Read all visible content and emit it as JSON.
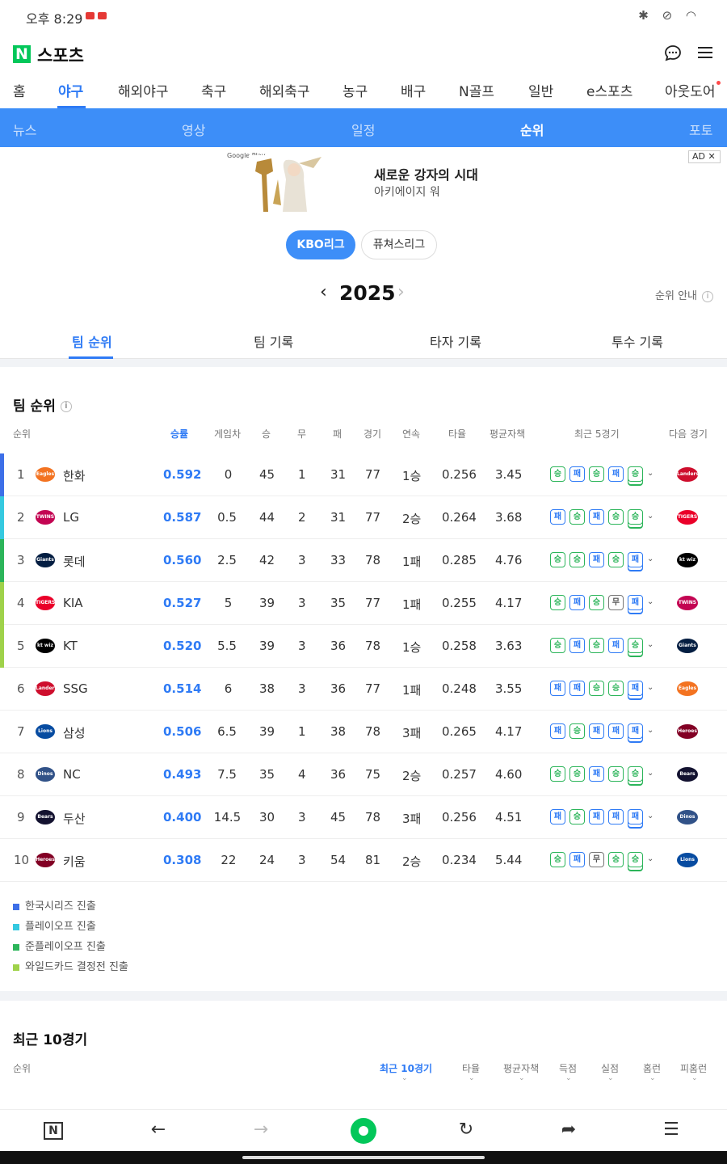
{
  "status": {
    "time": "오후 8:29",
    "icons": "✱ ⊘ ◠"
  },
  "header": {
    "logo_n": "N",
    "title": "스포츠",
    "chat_icon": "💬",
    "menu_icon": "☰"
  },
  "categories": [
    "홈",
    "야구",
    "해외야구",
    "축구",
    "해외축구",
    "농구",
    "배구",
    "N골프",
    "일반",
    "e스포츠",
    "아웃도어"
  ],
  "subnav": [
    "뉴스",
    "영상",
    "일정",
    "순위",
    "포토"
  ],
  "ad": {
    "store": "Google Play",
    "title": "새로운 강자의 시대",
    "subtitle": "아키에이지 워",
    "badge": "AD ✕"
  },
  "league_tabs": [
    "KBO리그",
    "퓨쳐스리그"
  ],
  "season": {
    "year": "2025",
    "prev": "‹",
    "next": "›",
    "guide": "순위 안내"
  },
  "record_tabs": [
    "팀 순위",
    "팀 기록",
    "타자 기록",
    "투수 기록"
  ],
  "standings": {
    "title": "팀 순위",
    "headers": [
      "순위",
      "승률",
      "게임차",
      "승",
      "무",
      "패",
      "경기",
      "연속",
      "타율",
      "평균자책",
      "최근 5경기",
      "다음 경기"
    ],
    "rows": [
      {
        "rank": "1",
        "team": "한화",
        "logo": "Eagles",
        "pct": "0.592",
        "gb": "0",
        "w": "45",
        "d": "1",
        "l": "31",
        "g": "77",
        "streak": "1승",
        "avg": "0.256",
        "era": "3.45",
        "last5": [
          "승",
          "패",
          "승",
          "패",
          "승"
        ],
        "next": "Landers"
      },
      {
        "rank": "2",
        "team": "LG",
        "logo": "TWINS",
        "pct": "0.587",
        "gb": "0.5",
        "w": "44",
        "d": "2",
        "l": "31",
        "g": "77",
        "streak": "2승",
        "avg": "0.264",
        "era": "3.68",
        "last5": [
          "패",
          "승",
          "패",
          "승",
          "승"
        ],
        "next": "TIGERS"
      },
      {
        "rank": "3",
        "team": "롯데",
        "logo": "Giants",
        "pct": "0.560",
        "gb": "2.5",
        "w": "42",
        "d": "3",
        "l": "33",
        "g": "78",
        "streak": "1패",
        "avg": "0.285",
        "era": "4.76",
        "last5": [
          "승",
          "승",
          "패",
          "승",
          "패"
        ],
        "next": "kt wiz"
      },
      {
        "rank": "4",
        "team": "KIA",
        "logo": "TIGERS",
        "pct": "0.527",
        "gb": "5",
        "w": "39",
        "d": "3",
        "l": "35",
        "g": "77",
        "streak": "1패",
        "avg": "0.255",
        "era": "4.17",
        "last5": [
          "승",
          "패",
          "승",
          "무",
          "패"
        ],
        "next": "TWINS"
      },
      {
        "rank": "5",
        "team": "KT",
        "logo": "kt wiz",
        "pct": "0.520",
        "gb": "5.5",
        "w": "39",
        "d": "3",
        "l": "36",
        "g": "78",
        "streak": "1승",
        "avg": "0.258",
        "era": "3.63",
        "last5": [
          "승",
          "패",
          "승",
          "패",
          "승"
        ],
        "next": "Giants"
      },
      {
        "rank": "6",
        "team": "SSG",
        "logo": "Landers",
        "pct": "0.514",
        "gb": "6",
        "w": "38",
        "d": "3",
        "l": "36",
        "g": "77",
        "streak": "1패",
        "avg": "0.248",
        "era": "3.55",
        "last5": [
          "패",
          "패",
          "승",
          "승",
          "패"
        ],
        "next": "Eagles"
      },
      {
        "rank": "7",
        "team": "삼성",
        "logo": "Lions",
        "pct": "0.506",
        "gb": "6.5",
        "w": "39",
        "d": "1",
        "l": "38",
        "g": "78",
        "streak": "3패",
        "avg": "0.265",
        "era": "4.17",
        "last5": [
          "패",
          "승",
          "패",
          "패",
          "패"
        ],
        "next": "Heroes"
      },
      {
        "rank": "8",
        "team": "NC",
        "logo": "Dinos",
        "pct": "0.493",
        "gb": "7.5",
        "w": "35",
        "d": "4",
        "l": "36",
        "g": "75",
        "streak": "2승",
        "avg": "0.257",
        "era": "4.60",
        "last5": [
          "승",
          "승",
          "패",
          "승",
          "승"
        ],
        "next": "Bears"
      },
      {
        "rank": "9",
        "team": "두산",
        "logo": "Bears",
        "pct": "0.400",
        "gb": "14.5",
        "w": "30",
        "d": "3",
        "l": "45",
        "g": "78",
        "streak": "3패",
        "avg": "0.256",
        "era": "4.51",
        "last5": [
          "패",
          "승",
          "패",
          "패",
          "패"
        ],
        "next": "Dinos"
      },
      {
        "rank": "10",
        "team": "키움",
        "logo": "Heroes",
        "pct": "0.308",
        "gb": "22",
        "w": "24",
        "d": "3",
        "l": "54",
        "g": "81",
        "streak": "2승",
        "avg": "0.234",
        "era": "5.44",
        "last5": [
          "승",
          "패",
          "무",
          "승",
          "승"
        ],
        "next": "Lions"
      }
    ]
  },
  "legend": [
    {
      "label": "한국시리즈 진출",
      "color": "#3d6fe8"
    },
    {
      "label": "플레이오프 진출",
      "color": "#35c9e0"
    },
    {
      "label": "준플레이오프 진출",
      "color": "#2cb55a"
    },
    {
      "label": "와일드카드 결정전 진출",
      "color": "#9fd24a"
    }
  ],
  "recent10": {
    "title": "최근 10경기",
    "rank_header": "순위",
    "headers": [
      "최근 10경기",
      "타율",
      "평균자책",
      "득점",
      "실점",
      "홈런",
      "피홈런"
    ],
    "sort_icon": "⌄"
  },
  "bottombar": {
    "home_n": "N",
    "back": "←",
    "forward": "→",
    "reload": "↻",
    "share": "➦",
    "menu": "☰"
  },
  "colors": {
    "accent": "#2f7bf5",
    "subnav": "#3d8ef8",
    "win": "#2cb55a",
    "loss": "#2f7bf5",
    "naver": "#03c75a"
  }
}
